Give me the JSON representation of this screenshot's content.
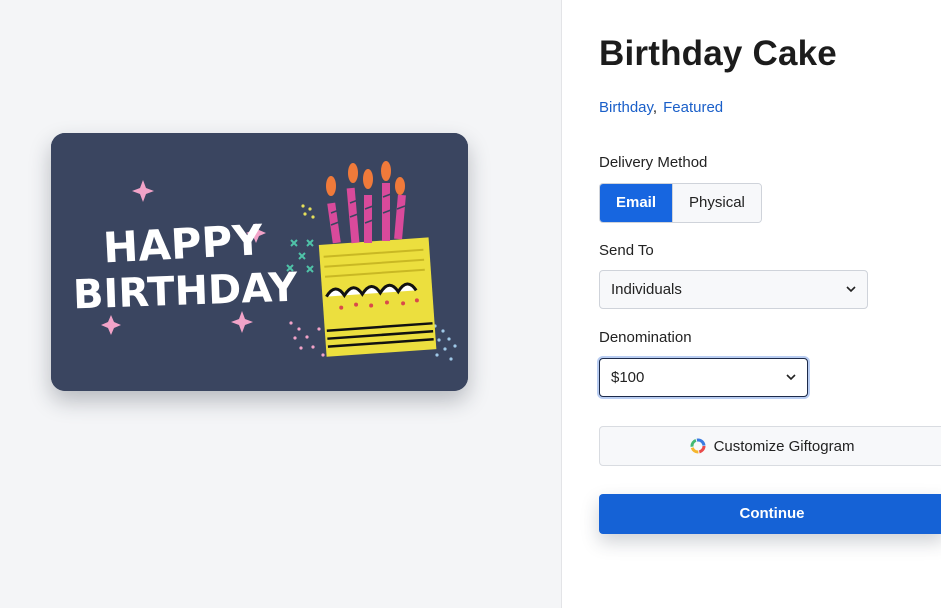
{
  "product": {
    "title": "Birthday Cake",
    "tags": [
      "Birthday",
      "Featured"
    ],
    "card_art_text": [
      "HAPPY",
      "BIRTHDAY"
    ]
  },
  "delivery": {
    "label": "Delivery Method",
    "options": [
      "Email",
      "Physical"
    ],
    "selected": "Email"
  },
  "send_to": {
    "label": "Send To",
    "value": "Individuals"
  },
  "denomination": {
    "label": "Denomination",
    "value": "$100"
  },
  "actions": {
    "customize_label": "Customize Giftogram",
    "continue_label": "Continue"
  },
  "colors": {
    "accent": "#1766e0",
    "card_bg": "#3a4560",
    "cake_yellow": "#ecdf3e",
    "candle_pink": "#d94a9b"
  },
  "icons": {
    "customize": "color-ring-icon",
    "dropdown": "chevron-down-icon"
  }
}
